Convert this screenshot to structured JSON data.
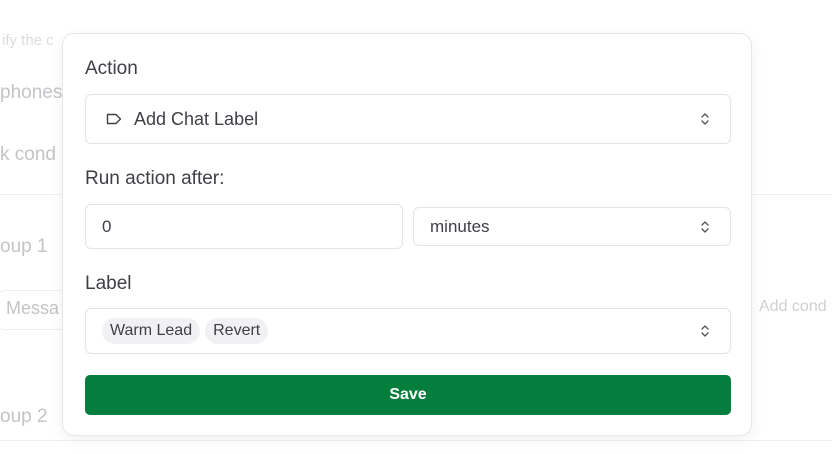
{
  "background": {
    "hint_text": "ify the c",
    "phones_text": "phones",
    "condition_text": "k cond",
    "group1_text": "oup 1",
    "message_text": "Messa",
    "add_condition_text": "Add cond",
    "group2_text": "oup 2"
  },
  "modal": {
    "action": {
      "label": "Action",
      "selected": "Add Chat Label",
      "icon": "tag-icon"
    },
    "run_after": {
      "label": "Run action after:",
      "value": "0",
      "unit": "minutes"
    },
    "label_field": {
      "label": "Label",
      "chips": [
        "Warm Lead",
        "Revert"
      ]
    },
    "save_label": "Save",
    "colors": {
      "save_button": "#047e3c",
      "chip_background": "#f1f1f4",
      "border": "#e4e4e7"
    }
  }
}
